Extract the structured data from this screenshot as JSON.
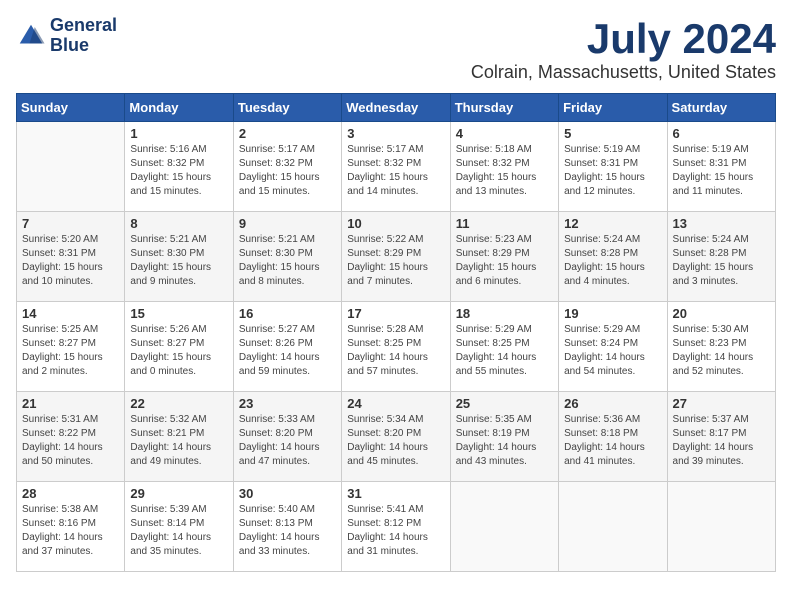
{
  "logo": {
    "line1": "General",
    "line2": "Blue"
  },
  "title": "July 2024",
  "location": "Colrain, Massachusetts, United States",
  "headers": [
    "Sunday",
    "Monday",
    "Tuesday",
    "Wednesday",
    "Thursday",
    "Friday",
    "Saturday"
  ],
  "weeks": [
    [
      {
        "day": "",
        "info": ""
      },
      {
        "day": "1",
        "info": "Sunrise: 5:16 AM\nSunset: 8:32 PM\nDaylight: 15 hours\nand 15 minutes."
      },
      {
        "day": "2",
        "info": "Sunrise: 5:17 AM\nSunset: 8:32 PM\nDaylight: 15 hours\nand 15 minutes."
      },
      {
        "day": "3",
        "info": "Sunrise: 5:17 AM\nSunset: 8:32 PM\nDaylight: 15 hours\nand 14 minutes."
      },
      {
        "day": "4",
        "info": "Sunrise: 5:18 AM\nSunset: 8:32 PM\nDaylight: 15 hours\nand 13 minutes."
      },
      {
        "day": "5",
        "info": "Sunrise: 5:19 AM\nSunset: 8:31 PM\nDaylight: 15 hours\nand 12 minutes."
      },
      {
        "day": "6",
        "info": "Sunrise: 5:19 AM\nSunset: 8:31 PM\nDaylight: 15 hours\nand 11 minutes."
      }
    ],
    [
      {
        "day": "7",
        "info": "Sunrise: 5:20 AM\nSunset: 8:31 PM\nDaylight: 15 hours\nand 10 minutes."
      },
      {
        "day": "8",
        "info": "Sunrise: 5:21 AM\nSunset: 8:30 PM\nDaylight: 15 hours\nand 9 minutes."
      },
      {
        "day": "9",
        "info": "Sunrise: 5:21 AM\nSunset: 8:30 PM\nDaylight: 15 hours\nand 8 minutes."
      },
      {
        "day": "10",
        "info": "Sunrise: 5:22 AM\nSunset: 8:29 PM\nDaylight: 15 hours\nand 7 minutes."
      },
      {
        "day": "11",
        "info": "Sunrise: 5:23 AM\nSunset: 8:29 PM\nDaylight: 15 hours\nand 6 minutes."
      },
      {
        "day": "12",
        "info": "Sunrise: 5:24 AM\nSunset: 8:28 PM\nDaylight: 15 hours\nand 4 minutes."
      },
      {
        "day": "13",
        "info": "Sunrise: 5:24 AM\nSunset: 8:28 PM\nDaylight: 15 hours\nand 3 minutes."
      }
    ],
    [
      {
        "day": "14",
        "info": "Sunrise: 5:25 AM\nSunset: 8:27 PM\nDaylight: 15 hours\nand 2 minutes."
      },
      {
        "day": "15",
        "info": "Sunrise: 5:26 AM\nSunset: 8:27 PM\nDaylight: 15 hours\nand 0 minutes."
      },
      {
        "day": "16",
        "info": "Sunrise: 5:27 AM\nSunset: 8:26 PM\nDaylight: 14 hours\nand 59 minutes."
      },
      {
        "day": "17",
        "info": "Sunrise: 5:28 AM\nSunset: 8:25 PM\nDaylight: 14 hours\nand 57 minutes."
      },
      {
        "day": "18",
        "info": "Sunrise: 5:29 AM\nSunset: 8:25 PM\nDaylight: 14 hours\nand 55 minutes."
      },
      {
        "day": "19",
        "info": "Sunrise: 5:29 AM\nSunset: 8:24 PM\nDaylight: 14 hours\nand 54 minutes."
      },
      {
        "day": "20",
        "info": "Sunrise: 5:30 AM\nSunset: 8:23 PM\nDaylight: 14 hours\nand 52 minutes."
      }
    ],
    [
      {
        "day": "21",
        "info": "Sunrise: 5:31 AM\nSunset: 8:22 PM\nDaylight: 14 hours\nand 50 minutes."
      },
      {
        "day": "22",
        "info": "Sunrise: 5:32 AM\nSunset: 8:21 PM\nDaylight: 14 hours\nand 49 minutes."
      },
      {
        "day": "23",
        "info": "Sunrise: 5:33 AM\nSunset: 8:20 PM\nDaylight: 14 hours\nand 47 minutes."
      },
      {
        "day": "24",
        "info": "Sunrise: 5:34 AM\nSunset: 8:20 PM\nDaylight: 14 hours\nand 45 minutes."
      },
      {
        "day": "25",
        "info": "Sunrise: 5:35 AM\nSunset: 8:19 PM\nDaylight: 14 hours\nand 43 minutes."
      },
      {
        "day": "26",
        "info": "Sunrise: 5:36 AM\nSunset: 8:18 PM\nDaylight: 14 hours\nand 41 minutes."
      },
      {
        "day": "27",
        "info": "Sunrise: 5:37 AM\nSunset: 8:17 PM\nDaylight: 14 hours\nand 39 minutes."
      }
    ],
    [
      {
        "day": "28",
        "info": "Sunrise: 5:38 AM\nSunset: 8:16 PM\nDaylight: 14 hours\nand 37 minutes."
      },
      {
        "day": "29",
        "info": "Sunrise: 5:39 AM\nSunset: 8:14 PM\nDaylight: 14 hours\nand 35 minutes."
      },
      {
        "day": "30",
        "info": "Sunrise: 5:40 AM\nSunset: 8:13 PM\nDaylight: 14 hours\nand 33 minutes."
      },
      {
        "day": "31",
        "info": "Sunrise: 5:41 AM\nSunset: 8:12 PM\nDaylight: 14 hours\nand 31 minutes."
      },
      {
        "day": "",
        "info": ""
      },
      {
        "day": "",
        "info": ""
      },
      {
        "day": "",
        "info": ""
      }
    ]
  ]
}
